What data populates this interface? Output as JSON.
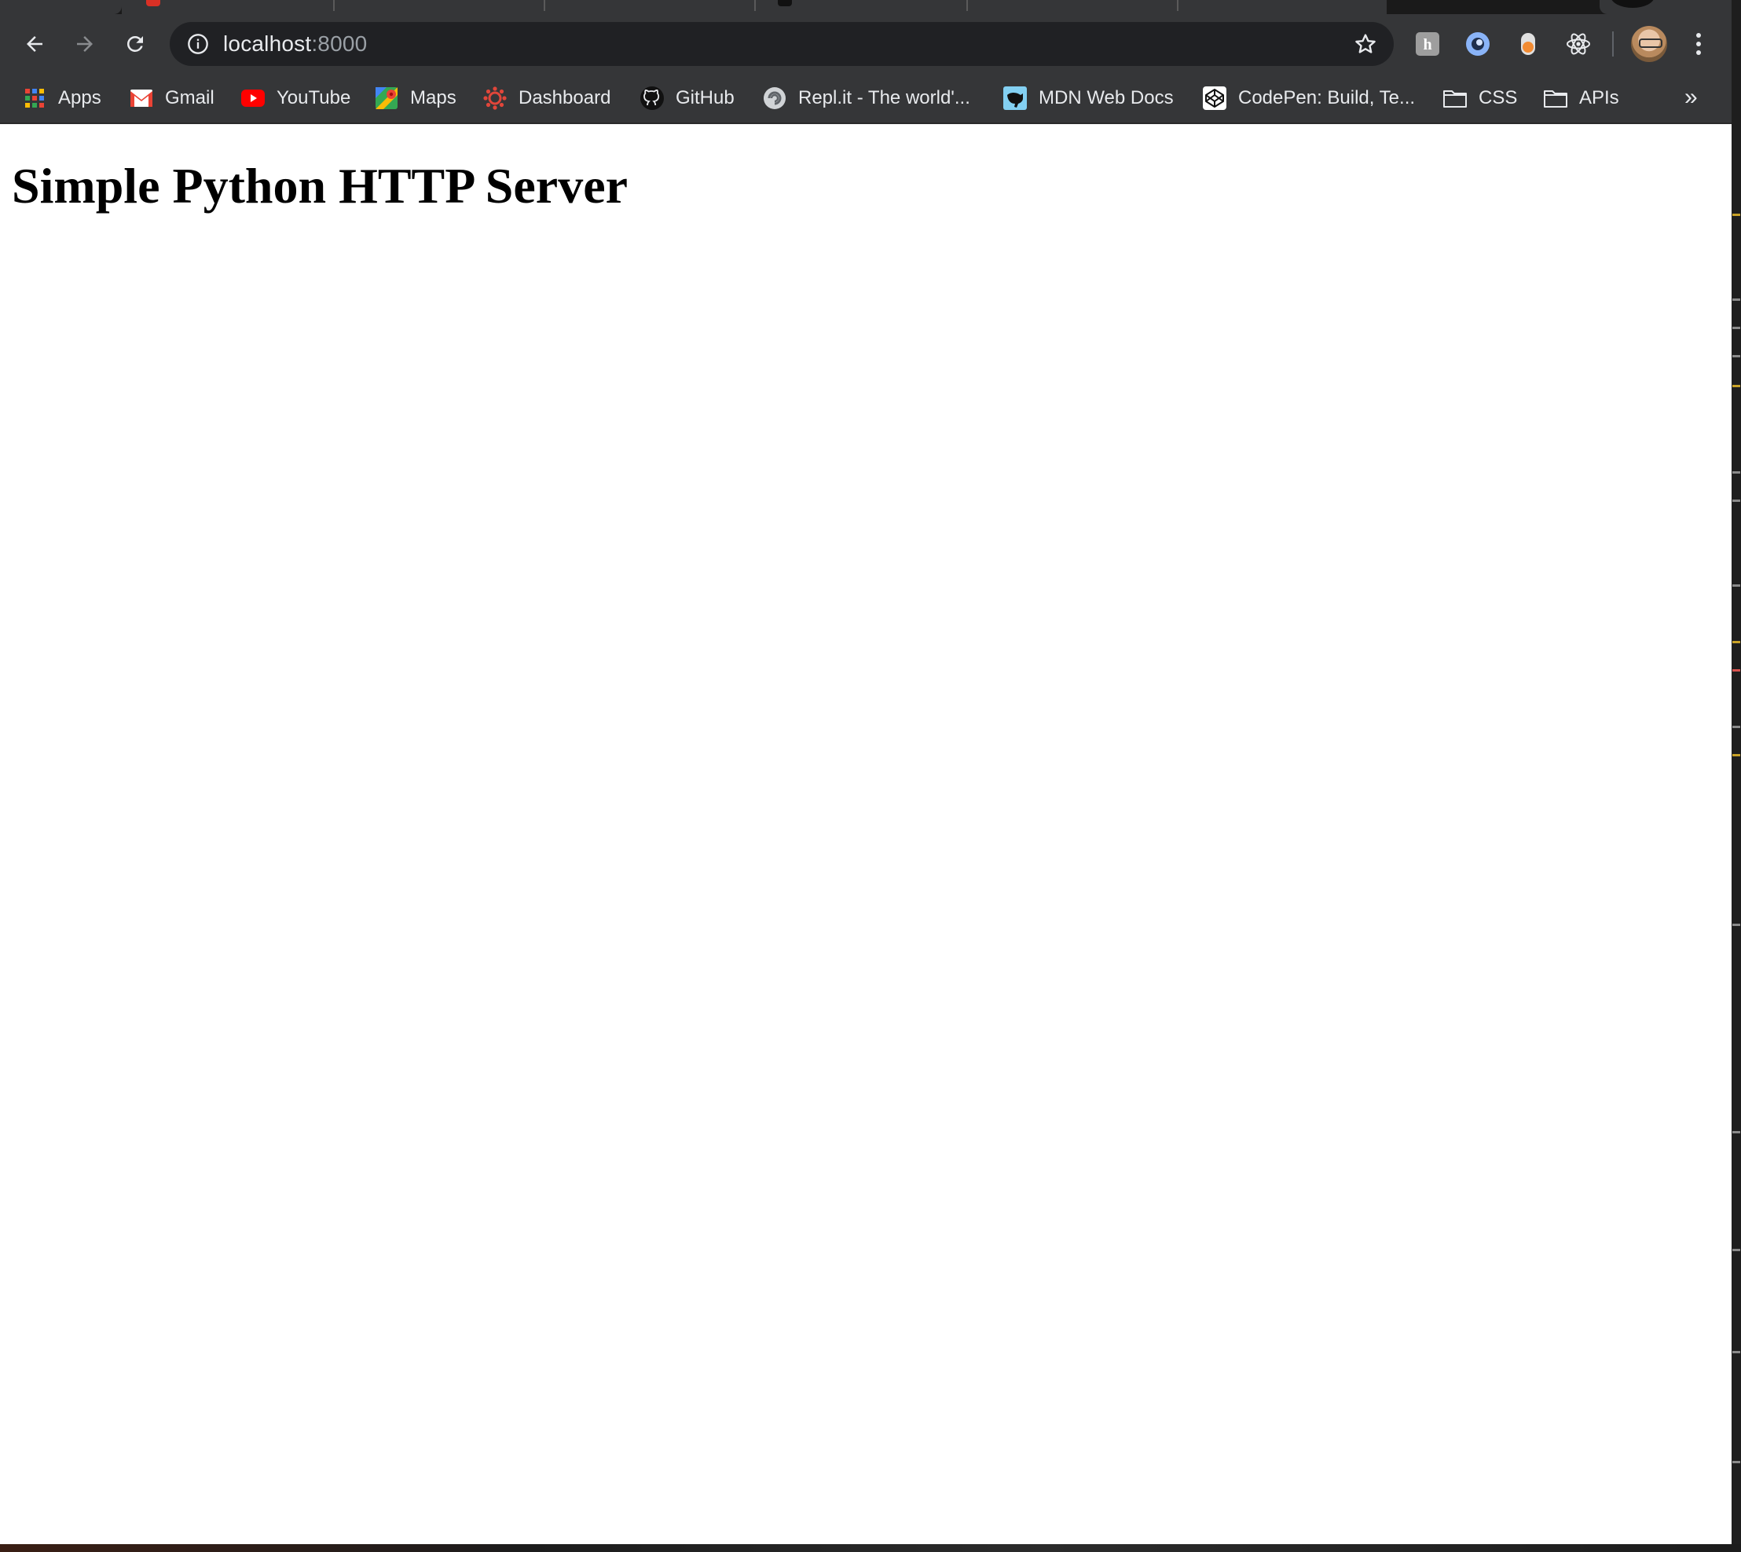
{
  "browser": {
    "url_host": "localhost",
    "url_port": ":8000"
  },
  "bookmarks": [
    {
      "label": "Apps",
      "icon": "apps-grid-icon"
    },
    {
      "label": "Gmail",
      "icon": "gmail-icon"
    },
    {
      "label": "YouTube",
      "icon": "youtube-icon"
    },
    {
      "label": "Maps",
      "icon": "maps-icon"
    },
    {
      "label": "Dashboard",
      "icon": "dashboard-icon"
    },
    {
      "label": "GitHub",
      "icon": "github-icon"
    },
    {
      "label": "Repl.it - The world'...",
      "icon": "replit-icon"
    },
    {
      "label": "MDN Web Docs",
      "icon": "mdn-icon"
    },
    {
      "label": "CodePen: Build, Te...",
      "icon": "codepen-icon"
    },
    {
      "label": "CSS",
      "icon": "folder-icon"
    },
    {
      "label": "APIs",
      "icon": "folder-icon"
    }
  ],
  "bookmarks_overflow": "»",
  "extensions": [
    "hackmd-extension-icon",
    "ring-extension-icon",
    "toggle-extension-icon",
    "react-devtools-icon"
  ],
  "page": {
    "heading": "Simple Python HTTP Server"
  },
  "colors": {
    "toolbar_bg": "#353638",
    "omnibox_bg": "#202124",
    "text_light": "#e8eaed",
    "text_dim": "#9aa0a6",
    "page_bg": "#ffffff"
  }
}
